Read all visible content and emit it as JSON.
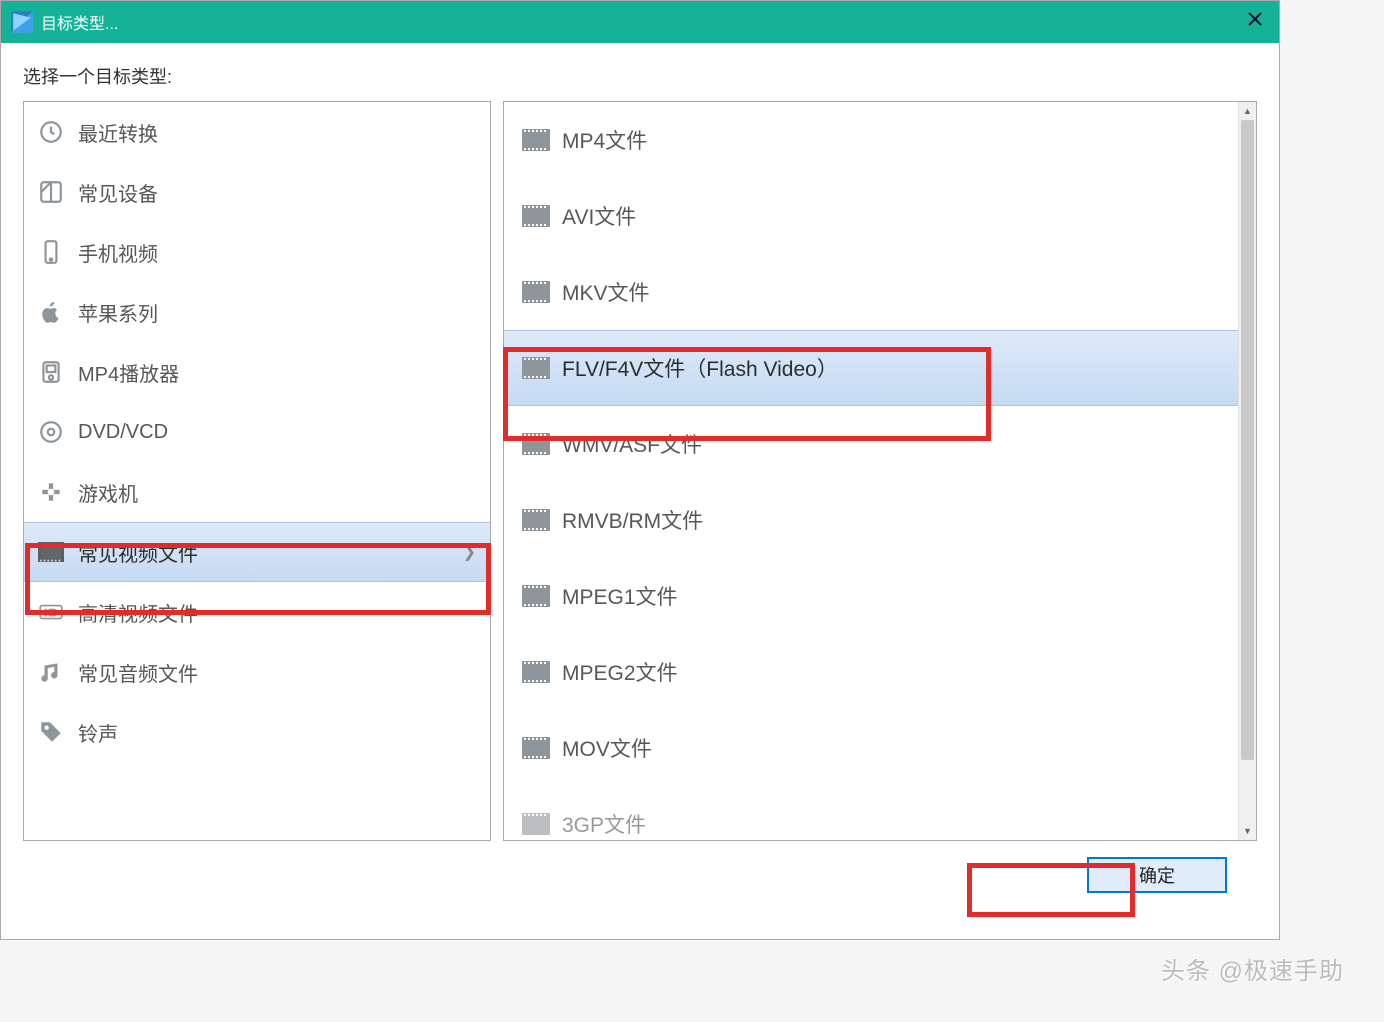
{
  "window": {
    "title": "目标类型..."
  },
  "prompt": "选择一个目标类型:",
  "categories": [
    {
      "label": "最近转换",
      "icon": "clock-icon"
    },
    {
      "label": "常见设备",
      "icon": "devices-icon"
    },
    {
      "label": "手机视频",
      "icon": "phone-icon"
    },
    {
      "label": "苹果系列",
      "icon": "apple-icon"
    },
    {
      "label": "MP4播放器",
      "icon": "player-icon"
    },
    {
      "label": "DVD/VCD",
      "icon": "disc-icon"
    },
    {
      "label": "游戏机",
      "icon": "gamepad-icon"
    },
    {
      "label": "常见视频文件",
      "icon": "film-icon",
      "selected": true
    },
    {
      "label": "高清视频文件",
      "icon": "hd-icon"
    },
    {
      "label": "常见音频文件",
      "icon": "music-icon"
    },
    {
      "label": "铃声",
      "icon": "tag-icon"
    }
  ],
  "files": [
    {
      "label": "MP4文件"
    },
    {
      "label": "AVI文件"
    },
    {
      "label": "MKV文件"
    },
    {
      "label": "FLV/F4V文件（Flash Video）",
      "selected": true
    },
    {
      "label": "WMV/ASF文件"
    },
    {
      "label": "RMVB/RM文件"
    },
    {
      "label": "MPEG1文件"
    },
    {
      "label": "MPEG2文件"
    },
    {
      "label": "MOV文件"
    },
    {
      "label": "3GP文件"
    }
  ],
  "buttons": {
    "ok": "确定"
  },
  "watermark": "头条 @极速手助"
}
